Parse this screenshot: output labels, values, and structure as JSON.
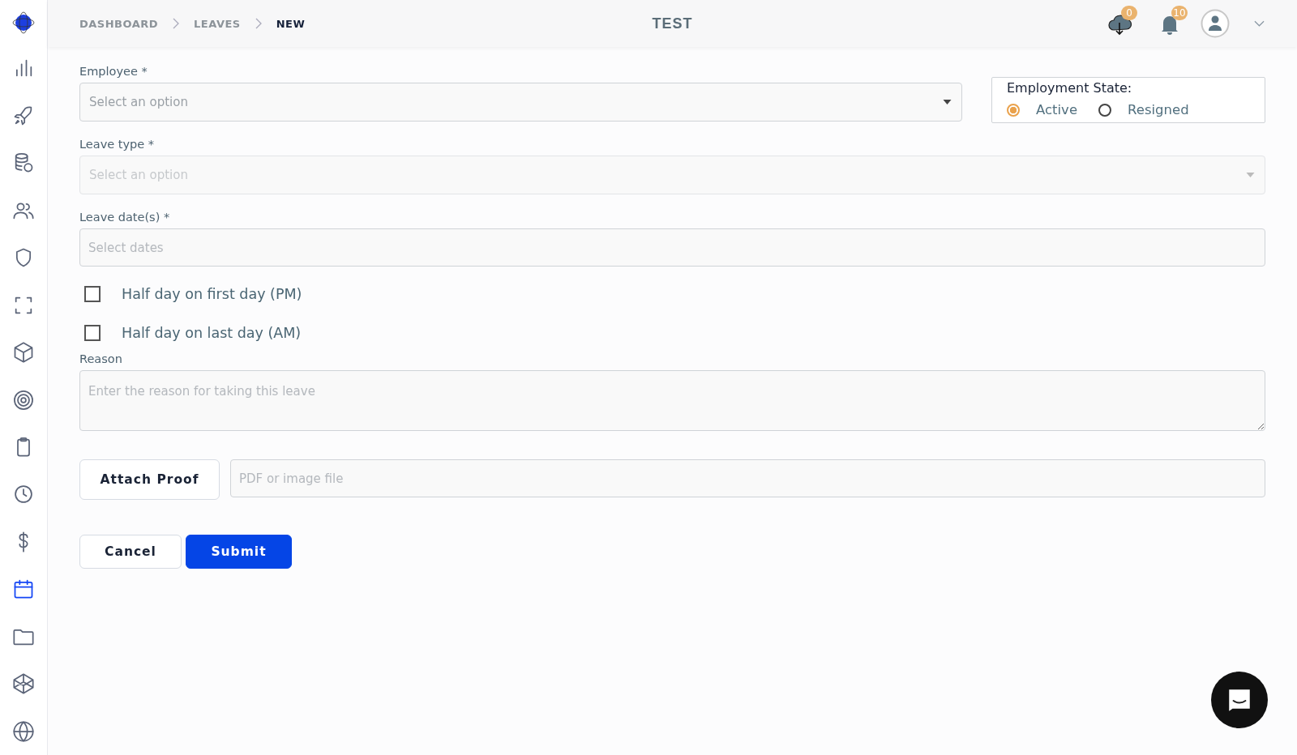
{
  "breadcrumb": [
    {
      "label": "DASHBOARD",
      "current": false
    },
    {
      "label": "LEAVES",
      "current": false
    },
    {
      "label": "NEW",
      "current": true
    }
  ],
  "header": {
    "title": "TEST",
    "downloads_badge": "0",
    "notifications_badge": "10"
  },
  "sidebar": {
    "items": [
      {
        "selected": false
      },
      {
        "selected": false
      },
      {
        "selected": false
      },
      {
        "selected": false
      },
      {
        "selected": false
      },
      {
        "selected": false
      },
      {
        "selected": false
      },
      {
        "selected": false
      },
      {
        "selected": false
      },
      {
        "selected": false
      },
      {
        "selected": false
      },
      {
        "selected": true
      },
      {
        "selected": false
      },
      {
        "selected": false
      },
      {
        "selected": false
      }
    ]
  },
  "form": {
    "employee": {
      "label": "Employee *",
      "placeholder": "Select an option",
      "disabled": false
    },
    "employment_state": {
      "label": "Employment State:",
      "options": [
        {
          "label": "Active",
          "selected": true
        },
        {
          "label": "Resigned",
          "selected": false
        }
      ]
    },
    "leave_type": {
      "label": "Leave type *",
      "placeholder": "Select an option",
      "disabled": true
    },
    "leave_dates": {
      "label": "Leave date(s) *",
      "placeholder": "Select dates"
    },
    "checkboxes": [
      {
        "label": "Half day on first day (PM)",
        "checked": false
      },
      {
        "label": "Half day on last day (AM)",
        "checked": false
      }
    ],
    "reason": {
      "label": "Reason",
      "placeholder": "Enter the reason for taking this leave"
    },
    "attach_button": "Attach Proof",
    "file_field": {
      "placeholder": "PDF or image file"
    },
    "buttons": [
      {
        "label": "Cancel",
        "kind": "secondary"
      },
      {
        "label": "Submit",
        "kind": "primary"
      }
    ]
  }
}
